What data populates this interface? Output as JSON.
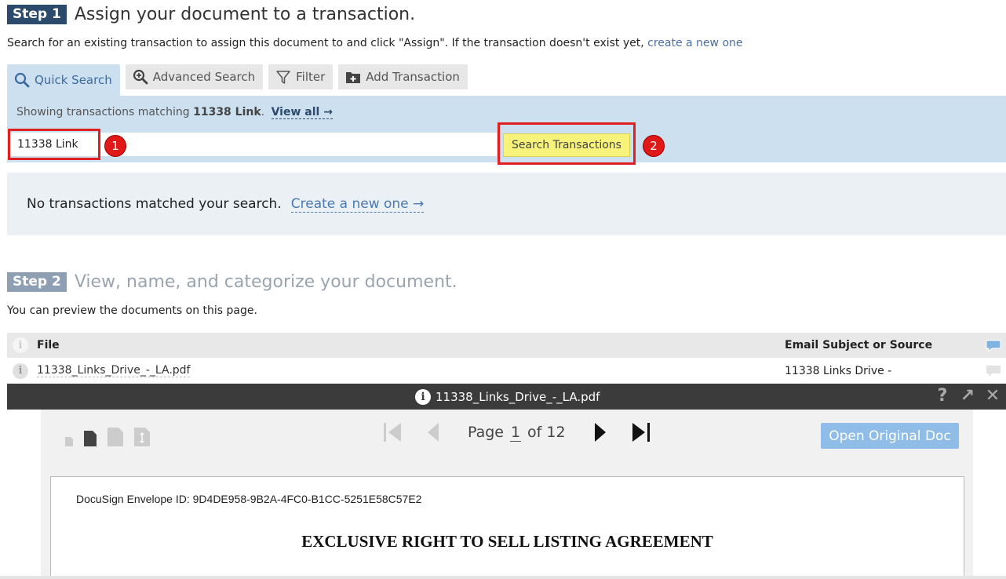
{
  "step1": {
    "badge": "Step 1",
    "heading": "Assign your document to a transaction.",
    "description": "Search for an existing transaction to assign this document to and click \"Assign\". If the transaction doesn't exist yet,",
    "description_link": "create a new one"
  },
  "tabs": [
    {
      "label": "Quick Search",
      "icon": "search-icon",
      "active": true
    },
    {
      "label": "Advanced Search",
      "icon": "zoom-in-icon",
      "active": false
    },
    {
      "label": "Filter",
      "icon": "filter-icon",
      "active": false
    },
    {
      "label": "Add Transaction",
      "icon": "add-folder-icon",
      "active": false
    }
  ],
  "search": {
    "showing_prefix": "Showing transactions matching",
    "query_term": "11338 Link",
    "showing_suffix": ".",
    "view_all": "View all →",
    "input_value": "11338 Link",
    "button_label": "Search Transactions",
    "annotation_1": "1",
    "annotation_2": "2"
  },
  "results": {
    "message": "No transactions matched your search.",
    "create_link": "Create a new one →"
  },
  "step2": {
    "badge": "Step 2",
    "heading": "View, name, and categorize your document.",
    "description": "You can preview the documents on this page."
  },
  "file_table": {
    "col_file": "File",
    "col_email": "Email Subject or Source",
    "rows": [
      {
        "file": "11338_Links_Drive_-_LA.pdf",
        "email": "11338 Links Drive -"
      }
    ]
  },
  "viewer": {
    "title": "11338_Links_Drive_-_LA.pdf",
    "page_label": "Page",
    "current_page": "1",
    "of_label": "of 12",
    "open_button": "Open Original Doc",
    "envelope_id": "DocuSign Envelope ID: 9D4DE958-9B2A-4FC0-B1CC-5251E58C57E2",
    "doc_title": "EXCLUSIVE RIGHT TO SELL LISTING AGREEMENT"
  },
  "colors": {
    "step1_badge": "#2c4a6b",
    "step2_badge": "#8e9fb3",
    "panel_blue": "#cde0f0",
    "highlight_red": "#e02020",
    "search_button_yellow": "#f6f27a",
    "open_button_blue": "#8fbde8"
  }
}
